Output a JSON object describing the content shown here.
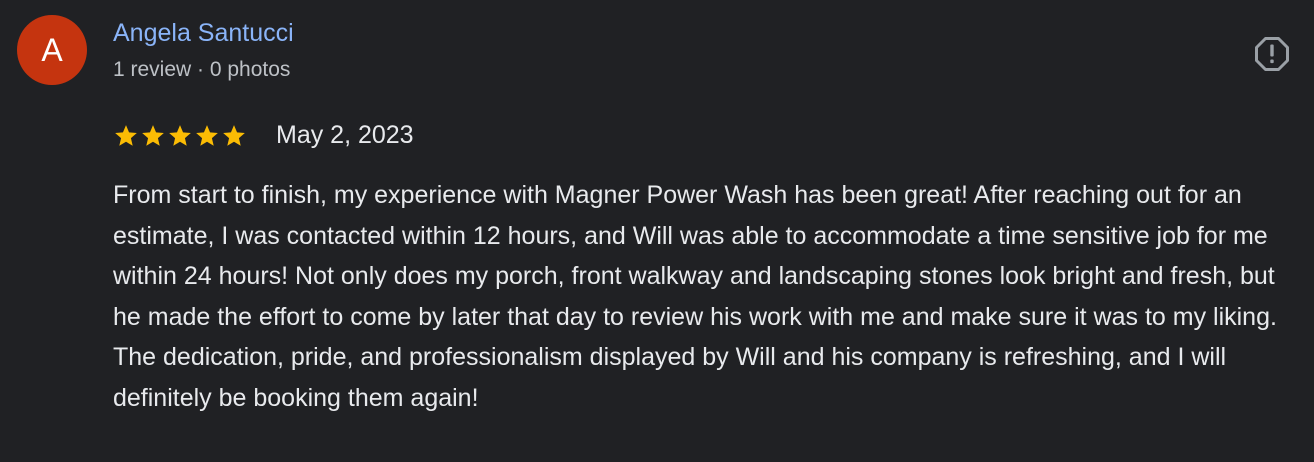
{
  "reviewer": {
    "avatar_letter": "A",
    "avatar_color": "#c5340f",
    "name": "Angela Santucci",
    "meta": "1 review · 0 photos"
  },
  "rating": {
    "stars": 5,
    "max_stars": 5,
    "star_color": "#fbbc04"
  },
  "review": {
    "date": "May 2, 2023",
    "text": "From start to finish, my experience with Magner Power Wash has been great! After reaching out for an estimate, I was contacted within 12 hours, and Will was able to accommodate a time sensitive job for me within 24 hours! Not only does my porch, front walkway and landscaping stones look bright and fresh, but he made the effort to come by later that day to review his work with me and make sure it was to my liking. The dedication, pride, and professionalism displayed by Will and his company is refreshing, and I will definitely be booking them again!"
  },
  "actions": {
    "flag_icon": "flag-report-icon"
  },
  "colors": {
    "background": "#202124",
    "name_link": "#8ab4f8",
    "primary_text": "#e8eaed",
    "secondary_text": "#bdc1c6"
  }
}
